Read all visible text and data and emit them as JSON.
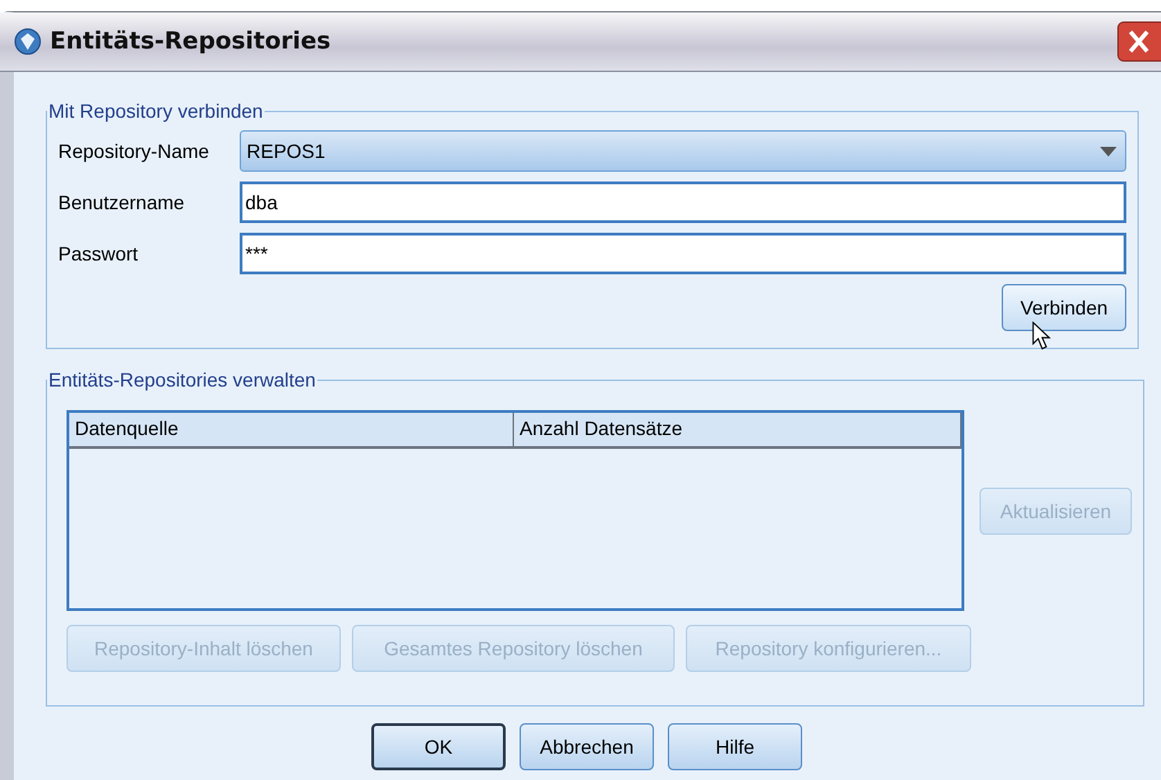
{
  "window": {
    "title": "Entitäts-Repositories"
  },
  "connect_group": {
    "title": "Mit Repository verbinden",
    "repository_name": {
      "label": "Repository-Name",
      "value": "REPOS1"
    },
    "username": {
      "label": "Benutzername",
      "value": "dba"
    },
    "password": {
      "label": "Passwort",
      "value": "***"
    },
    "connect_button": {
      "label": "Verbinden",
      "hovered": true
    }
  },
  "manage_group": {
    "title": "Entitäts-Repositories verwalten",
    "table": {
      "columns": [
        "Datenquelle",
        "Anzahl Datensätze"
      ]
    },
    "refresh_button": {
      "label": "Aktualisieren",
      "disabled": true
    },
    "buttons": [
      {
        "label": "Repository-Inhalt löschen",
        "disabled": true
      },
      {
        "label": "Gesamtes Repository löschen",
        "disabled": true
      },
      {
        "label": "Repository konfigurieren...",
        "disabled": true
      }
    ]
  },
  "dialog_buttons": [
    {
      "label": "OK",
      "default": true
    },
    {
      "label": "Abbrechen",
      "default": false
    },
    {
      "label": "Hilfe",
      "default": false
    }
  ]
}
